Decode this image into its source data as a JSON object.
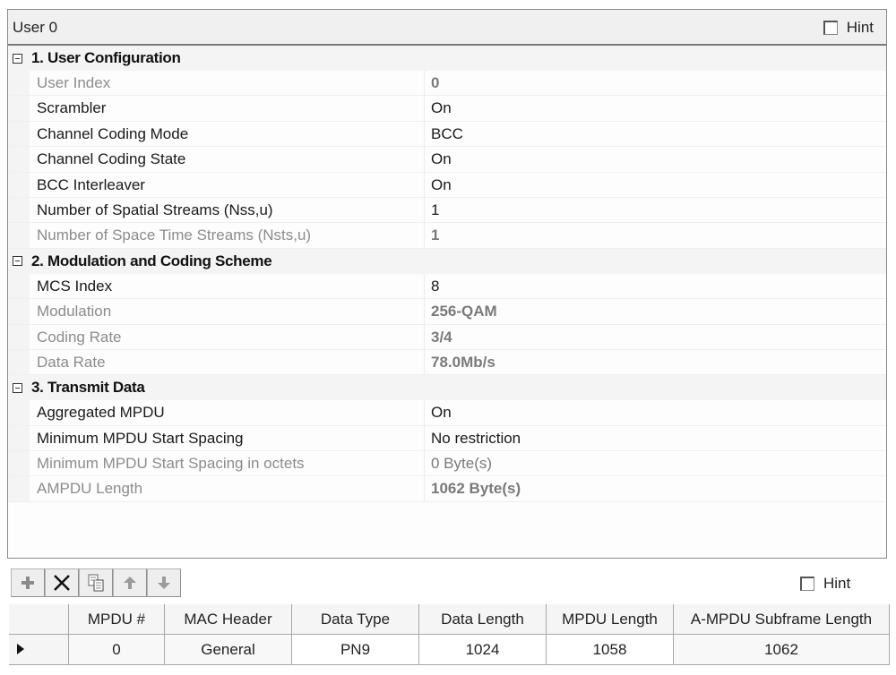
{
  "panel": {
    "title": "User 0",
    "hint_label": "Hint",
    "hint_checked": false
  },
  "categories": [
    {
      "title": "1. User Configuration",
      "expanded": true,
      "properties": [
        {
          "name": "User Index",
          "value": "0",
          "readonly": true,
          "bold": true
        },
        {
          "name": "Scrambler",
          "value": "On",
          "readonly": false,
          "bold": false
        },
        {
          "name": "Channel Coding Mode",
          "value": "BCC",
          "readonly": false,
          "bold": false
        },
        {
          "name": "Channel Coding State",
          "value": "On",
          "readonly": false,
          "bold": false
        },
        {
          "name": "BCC Interleaver",
          "value": "On",
          "readonly": false,
          "bold": false
        },
        {
          "name": "Number of Spatial Streams (Nss,u)",
          "value": "1",
          "readonly": false,
          "bold": false
        },
        {
          "name": "Number of Space Time Streams (Nsts,u)",
          "value": "1",
          "readonly": true,
          "bold": true
        }
      ]
    },
    {
      "title": "2. Modulation and Coding Scheme",
      "expanded": true,
      "properties": [
        {
          "name": "MCS Index",
          "value": "8",
          "readonly": false,
          "bold": false
        },
        {
          "name": "Modulation",
          "value": "256-QAM",
          "readonly": true,
          "bold": true
        },
        {
          "name": "Coding Rate",
          "value": "3/4",
          "readonly": true,
          "bold": true
        },
        {
          "name": "Data Rate",
          "value": "78.0Mb/s",
          "readonly": true,
          "bold": true
        }
      ]
    },
    {
      "title": "3. Transmit Data",
      "expanded": true,
      "properties": [
        {
          "name": "Aggregated MPDU",
          "value": "On",
          "readonly": false,
          "bold": false
        },
        {
          "name": "Minimum MPDU Start Spacing",
          "value": "No restriction",
          "readonly": false,
          "bold": false
        },
        {
          "name": "Minimum MPDU Start Spacing in octets",
          "value": "0 Byte(s)",
          "readonly": true,
          "bold": false
        },
        {
          "name": "AMPDU Length",
          "value": "1062 Byte(s)",
          "readonly": true,
          "bold": true
        }
      ]
    }
  ],
  "toolbar": {
    "buttons": [
      {
        "id": "add",
        "icon": "plus-icon",
        "tooltip": ""
      },
      {
        "id": "delete",
        "icon": "x-icon",
        "tooltip": ""
      },
      {
        "id": "copy",
        "icon": "copy-icon",
        "tooltip": ""
      },
      {
        "id": "move-up",
        "icon": "arrow-up-icon",
        "tooltip": ""
      },
      {
        "id": "move-down",
        "icon": "arrow-down-icon",
        "tooltip": ""
      }
    ],
    "hint_label": "Hint",
    "hint_checked": false
  },
  "mpdu_table": {
    "columns": [
      "MPDU #",
      "MAC Header",
      "Data Type",
      "Data Length",
      "MPDU Length",
      "A-MPDU Subframe Length"
    ],
    "rows": [
      {
        "selected": true,
        "cells": [
          "0",
          "General",
          "PN9",
          "1024",
          "1058",
          "1062"
        ]
      }
    ]
  }
}
